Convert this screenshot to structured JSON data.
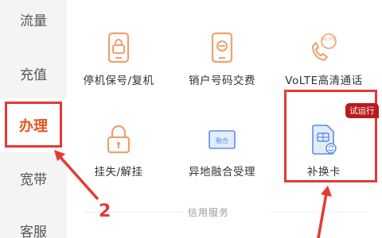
{
  "sidebar": {
    "items": [
      {
        "label": "流量"
      },
      {
        "label": "充值"
      },
      {
        "label": "办理"
      },
      {
        "label": "宽带"
      },
      {
        "label": "客服"
      }
    ]
  },
  "grid": {
    "tiles": [
      {
        "label": "停机保号/复机",
        "icon": "phone-lock-icon"
      },
      {
        "label": "销户号码交费",
        "icon": "phone-cancel-icon"
      },
      {
        "label": "VoLTE高清通话",
        "icon": "volte-call-icon"
      },
      {
        "label": "挂失/解挂",
        "icon": "padlock-icon"
      },
      {
        "label": "异地融合受理",
        "icon": "fusion-card-icon",
        "icon_text": "融合"
      },
      {
        "label": "补换卡",
        "icon": "sim-swap-icon"
      }
    ],
    "badge": "试运行",
    "volte_icon_text": "Vo LTE"
  },
  "section": {
    "label": "信用服务"
  },
  "annotation": {
    "number": "2"
  },
  "colors": {
    "accent": "#e8541e",
    "highlight_red": "#e53935",
    "icon_orange": "#f0a06a",
    "icon_blue": "#5b8def",
    "badge_bg": "#b71c1c"
  }
}
